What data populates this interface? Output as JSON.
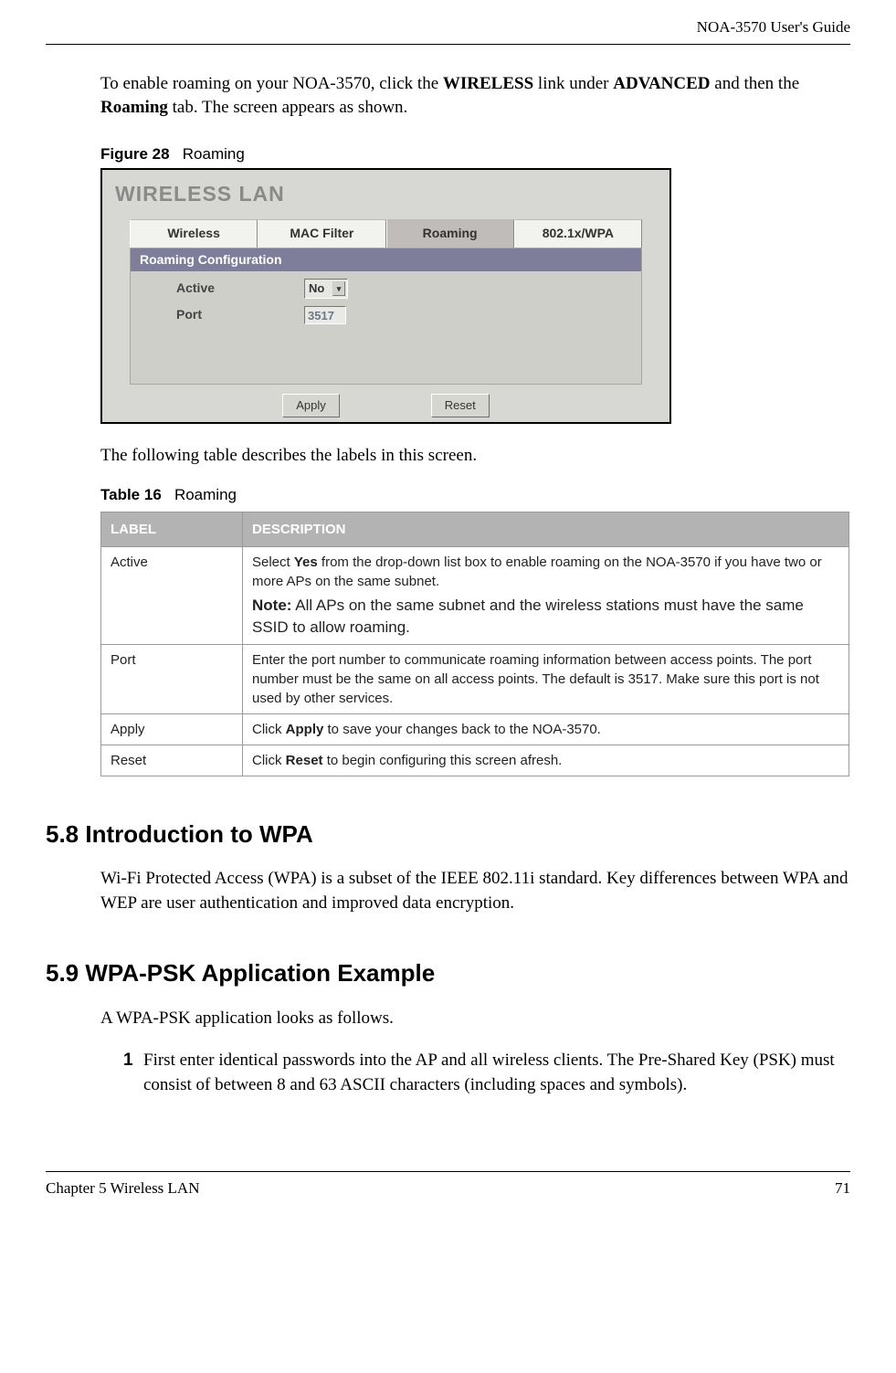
{
  "header": {
    "doc_title": "NOA-3570 User's Guide"
  },
  "intro": {
    "pre": "To enable roaming on your NOA-3570, click the ",
    "b1": "WIRELESS",
    "mid1": " link under ",
    "b2": "ADVANCED",
    "mid2": " and then the ",
    "b3": "Roaming",
    "post": " tab. The screen appears as shown."
  },
  "figure": {
    "label": "Figure 28",
    "title": "Roaming"
  },
  "ui": {
    "title": "WIRELESS LAN",
    "tabs": {
      "t1": "Wireless",
      "t2": "MAC Filter",
      "t3": "Roaming",
      "t4": "802.1x/WPA"
    },
    "panel_header": "Roaming Configuration",
    "active_label": "Active",
    "active_value": "No",
    "port_label": "Port",
    "port_value": "3517",
    "apply": "Apply",
    "reset": "Reset"
  },
  "after_fig": "The following table describes the labels in this screen.",
  "table_caption": {
    "label": "Table 16",
    "title": "Roaming"
  },
  "table": {
    "h1": "LABEL",
    "h2": "DESCRIPTION",
    "rows": [
      {
        "label": "Active",
        "d1": "Select ",
        "d1b": "Yes",
        "d1post": " from the drop-down list box to enable roaming on the NOA-3570 if you have two or more APs on the same subnet.",
        "note_b": "Note:",
        "note": " All APs on the same subnet and the wireless stations must have the same SSID to allow roaming."
      },
      {
        "label": "Port",
        "desc": "Enter the port number to communicate roaming information between access points. The port number must be the same on all access points. The default is 3517. Make sure this port is not used by other services."
      },
      {
        "label": "Apply",
        "d1": "Click ",
        "d1b": "Apply",
        "d1post": " to save your changes back to the NOA-3570."
      },
      {
        "label": "Reset",
        "d1": "Click ",
        "d1b": "Reset",
        "d1post": " to begin configuring this screen afresh."
      }
    ]
  },
  "sec58": {
    "heading": "5.8  Introduction to WPA",
    "body": "Wi-Fi Protected Access (WPA) is a subset of the IEEE 802.11i standard. Key differences between WPA and WEP are user authentication and improved data encryption."
  },
  "sec59": {
    "heading": "5.9  WPA-PSK Application Example",
    "body": "A WPA-PSK application looks as follows.",
    "item1_num": "1",
    "item1": "First enter identical passwords into the AP and all wireless clients. The Pre-Shared Key (PSK) must consist of between 8 and 63 ASCII characters (including spaces and symbols)."
  },
  "footer": {
    "chapter": "Chapter 5 Wireless LAN",
    "page": "71"
  }
}
